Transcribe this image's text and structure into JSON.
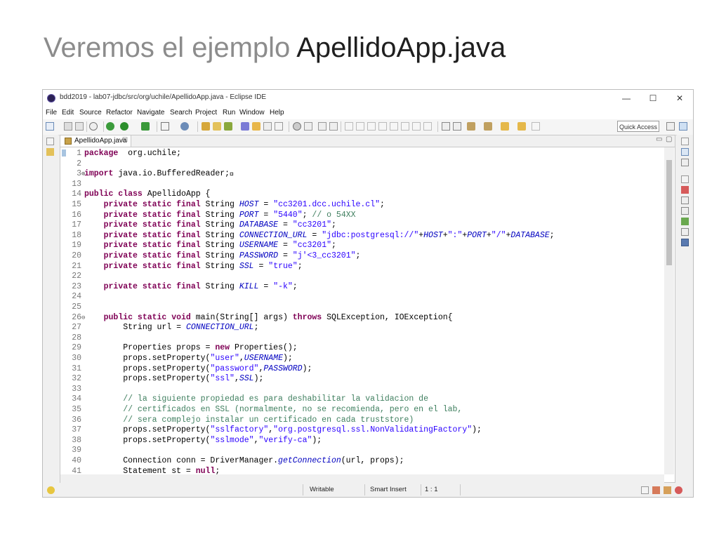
{
  "slide": {
    "title_part1": "Veremos el ejemplo ",
    "title_part2": "ApellidoApp.java"
  },
  "window": {
    "title": "bdd2019 - lab07-jdbc/src/org/uchile/ApellidoApp.java - Eclipse IDE",
    "minimize": "—",
    "maximize": "☐",
    "close": "✕"
  },
  "menu": [
    "File",
    "Edit",
    "Source",
    "Refactor",
    "Navigate",
    "Search",
    "Project",
    "Run",
    "Window",
    "Help"
  ],
  "toolbar": {
    "quick_access": "Quick Access"
  },
  "editor": {
    "tab_label": "ApellidoApp.java",
    "tab_close": "☒",
    "minimize": "▭",
    "maximize": "▢"
  },
  "code_lines": [
    {
      "n": "1",
      "segs": [
        [
          "kw",
          "package"
        ],
        [
          "",
          "  org.uchile;"
        ]
      ]
    },
    {
      "n": "2",
      "segs": []
    },
    {
      "n": "3",
      "fold": "⊕",
      "segs": [
        [
          "kw",
          "import"
        ],
        [
          "",
          " java.io.BufferedReader;⃞"
        ]
      ]
    },
    {
      "n": "13",
      "segs": []
    },
    {
      "n": "14",
      "segs": [
        [
          "kw",
          "public class"
        ],
        [
          "",
          " ApellidoApp {"
        ]
      ]
    },
    {
      "n": "15",
      "segs": [
        [
          "",
          "    "
        ],
        [
          "kw",
          "private static final"
        ],
        [
          "",
          " String "
        ],
        [
          "fld",
          "HOST"
        ],
        [
          "",
          " = "
        ],
        [
          "str",
          "\"cc3201.dcc.uchile.cl\""
        ],
        [
          "",
          ";"
        ]
      ]
    },
    {
      "n": "16",
      "segs": [
        [
          "",
          "    "
        ],
        [
          "kw",
          "private static final"
        ],
        [
          "",
          " String "
        ],
        [
          "fld",
          "PORT"
        ],
        [
          "",
          " = "
        ],
        [
          "str",
          "\"5440\""
        ],
        [
          "",
          "; "
        ],
        [
          "cmt",
          "// o 54XX"
        ]
      ]
    },
    {
      "n": "17",
      "segs": [
        [
          "",
          "    "
        ],
        [
          "kw",
          "private static final"
        ],
        [
          "",
          " String "
        ],
        [
          "fld",
          "DATABASE"
        ],
        [
          "",
          " = "
        ],
        [
          "str",
          "\"cc3201\""
        ],
        [
          "",
          ";"
        ]
      ]
    },
    {
      "n": "18",
      "segs": [
        [
          "",
          "    "
        ],
        [
          "kw",
          "private static final"
        ],
        [
          "",
          " String "
        ],
        [
          "fld",
          "CONNECTION_URL"
        ],
        [
          "",
          " = "
        ],
        [
          "str",
          "\"jdbc:postgresql://\""
        ],
        [
          "",
          "+"
        ],
        [
          "fld",
          "HOST"
        ],
        [
          "",
          "+"
        ],
        [
          "str",
          "\":\""
        ],
        [
          "",
          "+"
        ],
        [
          "fld",
          "PORT"
        ],
        [
          "",
          "+"
        ],
        [
          "str",
          "\"/\""
        ],
        [
          "",
          "+"
        ],
        [
          "fld",
          "DATABASE"
        ],
        [
          "",
          ";"
        ]
      ]
    },
    {
      "n": "19",
      "segs": [
        [
          "",
          "    "
        ],
        [
          "kw",
          "private static final"
        ],
        [
          "",
          " String "
        ],
        [
          "fld",
          "USERNAME"
        ],
        [
          "",
          " = "
        ],
        [
          "str",
          "\"cc3201\""
        ],
        [
          "",
          ";"
        ]
      ]
    },
    {
      "n": "20",
      "segs": [
        [
          "",
          "    "
        ],
        [
          "kw",
          "private static final"
        ],
        [
          "",
          " String "
        ],
        [
          "fld",
          "PASSWORD"
        ],
        [
          "",
          " = "
        ],
        [
          "str",
          "\"j'<3_cc3201\""
        ],
        [
          "",
          ";"
        ]
      ]
    },
    {
      "n": "21",
      "segs": [
        [
          "",
          "    "
        ],
        [
          "kw",
          "private static final"
        ],
        [
          "",
          " String "
        ],
        [
          "fld",
          "SSL"
        ],
        [
          "",
          " = "
        ],
        [
          "str",
          "\"true\""
        ],
        [
          "",
          ";"
        ]
      ]
    },
    {
      "n": "22",
      "segs": []
    },
    {
      "n": "23",
      "segs": [
        [
          "",
          "    "
        ],
        [
          "kw",
          "private static final"
        ],
        [
          "",
          " String "
        ],
        [
          "fld",
          "KILL"
        ],
        [
          "",
          " = "
        ],
        [
          "str",
          "\"-k\""
        ],
        [
          "",
          ";"
        ]
      ]
    },
    {
      "n": "24",
      "segs": []
    },
    {
      "n": "25",
      "segs": []
    },
    {
      "n": "26",
      "fold": "⊖",
      "segs": [
        [
          "",
          "    "
        ],
        [
          "kw",
          "public static void"
        ],
        [
          "",
          " main(String[] args) "
        ],
        [
          "kw",
          "throws"
        ],
        [
          "",
          " SQLException, IOException{"
        ]
      ]
    },
    {
      "n": "27",
      "segs": [
        [
          "",
          "        String url = "
        ],
        [
          "fld",
          "CONNECTION_URL"
        ],
        [
          "",
          ";"
        ]
      ]
    },
    {
      "n": "28",
      "segs": []
    },
    {
      "n": "29",
      "segs": [
        [
          "",
          "        Properties props = "
        ],
        [
          "kw",
          "new"
        ],
        [
          "",
          " Properties();"
        ]
      ]
    },
    {
      "n": "30",
      "segs": [
        [
          "",
          "        props.setProperty("
        ],
        [
          "str",
          "\"user\""
        ],
        [
          "",
          ","
        ],
        [
          "fld",
          "USERNAME"
        ],
        [
          "",
          ");"
        ]
      ]
    },
    {
      "n": "31",
      "segs": [
        [
          "",
          "        props.setProperty("
        ],
        [
          "str",
          "\"password\""
        ],
        [
          "",
          ","
        ],
        [
          "fld",
          "PASSWORD"
        ],
        [
          "",
          ");"
        ]
      ]
    },
    {
      "n": "32",
      "segs": [
        [
          "",
          "        props.setProperty("
        ],
        [
          "str",
          "\"ssl\""
        ],
        [
          "",
          ","
        ],
        [
          "fld",
          "SSL"
        ],
        [
          "",
          ");"
        ]
      ]
    },
    {
      "n": "33",
      "segs": []
    },
    {
      "n": "34",
      "segs": [
        [
          "",
          "        "
        ],
        [
          "cmt",
          "// la siguiente propiedad es para deshabilitar la validacion de"
        ]
      ]
    },
    {
      "n": "35",
      "segs": [
        [
          "",
          "        "
        ],
        [
          "cmt",
          "// certificados en SSL (normalmente, no se recomienda, pero en el lab,"
        ]
      ]
    },
    {
      "n": "36",
      "segs": [
        [
          "",
          "        "
        ],
        [
          "cmt",
          "// sera complejo instalar un certificado en cada truststore)"
        ]
      ]
    },
    {
      "n": "37",
      "segs": [
        [
          "",
          "        props.setProperty("
        ],
        [
          "str",
          "\"sslfactory\""
        ],
        [
          "",
          ","
        ],
        [
          "str",
          "\"org.postgresql.ssl.NonValidatingFactory\""
        ],
        [
          "",
          ");"
        ]
      ]
    },
    {
      "n": "38",
      "segs": [
        [
          "",
          "        props.setProperty("
        ],
        [
          "str",
          "\"sslmode\""
        ],
        [
          "",
          ","
        ],
        [
          "str",
          "\"verify-ca\""
        ],
        [
          "",
          ");"
        ]
      ]
    },
    {
      "n": "39",
      "segs": []
    },
    {
      "n": "40",
      "segs": [
        [
          "",
          "        Connection conn = DriverManager."
        ],
        [
          "fld",
          "getConnection"
        ],
        [
          "",
          "(url, props);"
        ]
      ]
    },
    {
      "n": "41",
      "segs": [
        [
          "",
          "        Statement st = "
        ],
        [
          "kw",
          "null"
        ],
        [
          "",
          ";"
        ]
      ]
    }
  ],
  "status": {
    "writable": "Writable",
    "insert_mode": "Smart Insert",
    "position": "1 : 1"
  },
  "colors": {
    "keyword": "#7f0055",
    "string": "#2a00ff",
    "field": "#0000c0",
    "comment": "#3f7f5f"
  }
}
